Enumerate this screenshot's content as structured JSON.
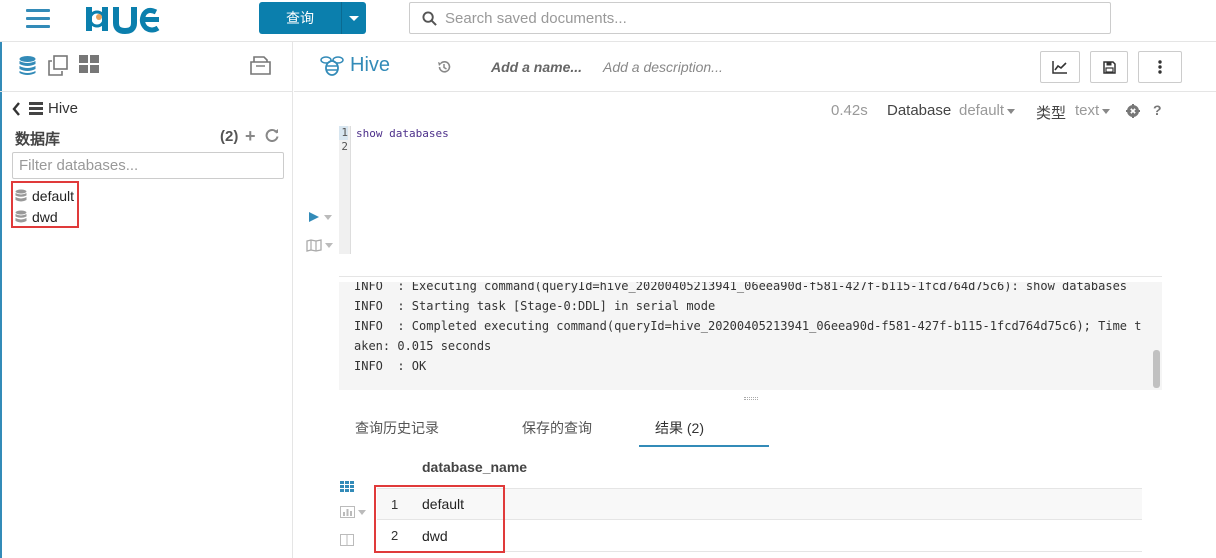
{
  "topbar": {
    "query_button_label": "查询",
    "search_placeholder": "Search saved documents..."
  },
  "sidebar": {
    "breadcrumb": "Hive",
    "databases_title": "数据库",
    "databases_count": "(2)",
    "filter_placeholder": "Filter databases...",
    "databases": [
      "default",
      "dwd"
    ]
  },
  "editor_header": {
    "title": "Hive",
    "name_placeholder": "Add a name...",
    "description_placeholder": "Add a description..."
  },
  "query_meta": {
    "execution_time": "0.42s",
    "database_label": "Database",
    "database_value": "default",
    "type_label": "类型",
    "type_value": "text"
  },
  "editor": {
    "line_numbers": [
      "1",
      "2"
    ],
    "code_lines": [
      "show databases",
      ""
    ]
  },
  "log": {
    "lines": [
      "INFO  : Executing command(queryId=hive_20200405213941_06eea90d-f581-427f-b115-1fcd764d75c6): show databases",
      "INFO  : Starting task [Stage-0:DDL] in serial mode",
      "INFO  : Completed executing command(queryId=hive_20200405213941_06eea90d-f581-427f-b115-1fcd764d75c6); Time t",
      "aken: 0.015 seconds",
      "INFO  : OK"
    ]
  },
  "tabs": [
    {
      "label": "查询历史记录"
    },
    {
      "label": "保存的查询"
    },
    {
      "label": "结果 (2)"
    }
  ],
  "results": {
    "column": "database_name",
    "rows": [
      {
        "index": "1",
        "value": "default"
      },
      {
        "index": "2",
        "value": "dwd"
      }
    ]
  },
  "colors": {
    "accent": "#338bb8",
    "primary_button": "#0b7fad",
    "highlight_box": "#e03a3a"
  }
}
